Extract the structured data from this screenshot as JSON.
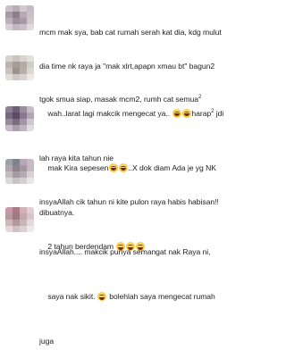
{
  "comments": [
    {
      "avatar_icon": "blurred-avatar-icon",
      "lines": [
        "mcm mak sya, bab cat rumah serah kat dia, kdg mulut",
        "dia time nk raya ja \"mak xlrt,apapn xmau bt\" bagun2",
        "tgok smua siap, masak mcm2, rumh cat semua"
      ],
      "emoji_after_line3": 1
    },
    {
      "avatar_icon": "blurred-avatar-icon",
      "lines": [
        "wah..larat lagi makcik mengecat ya.. ",
        "lah raya kita tahun nie"
      ],
      "mid": "harap",
      "after": " jdi"
    },
    {
      "avatar_icon": "blurred-avatar-icon",
      "text": "mak Kira sepesen",
      "after": "..X dok diam Ada je yg NK",
      "line2": "dibuatnya."
    },
    {
      "avatar_icon": "blurred-avatar-icon",
      "line1": "insyaAllah cik tahun ni kite pulon raya habis habisan!!",
      "line2": "2 tahun berdendam"
    },
    {
      "avatar_icon": "blurred-avatar-icon",
      "line1": "insyaAllah.... makcik punya semangat nak Raya ni,",
      "line2": "saya nak sikit. ",
      "line2b": " bolehlah saya mengecat rumah",
      "line3": "juga"
    }
  ],
  "superscript": "2"
}
